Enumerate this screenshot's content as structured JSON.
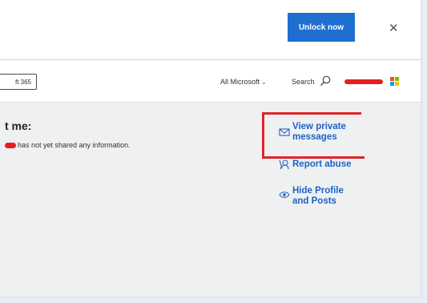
{
  "topbar": {
    "unlock_label": "Unlock now",
    "close_glyph": "✕"
  },
  "nav": {
    "m365_label": "ft 365",
    "all_microsoft": "All Microsoft",
    "chevron_glyph": "⌄",
    "search_label": "Search",
    "accent_color": "#1f6fd0"
  },
  "about": {
    "heading": "t me:",
    "text": "has not yet shared any information."
  },
  "actions": {
    "view_messages_line1": "View private",
    "view_messages_line2": "messages",
    "report_abuse": "Report abuse",
    "hide_profile_line1": "Hide Profile",
    "hide_profile_line2": "and Posts",
    "link_color": "#1d62c4"
  },
  "annotations": {
    "redaction_color": "#e4201f",
    "highlight_color": "#e02525"
  }
}
